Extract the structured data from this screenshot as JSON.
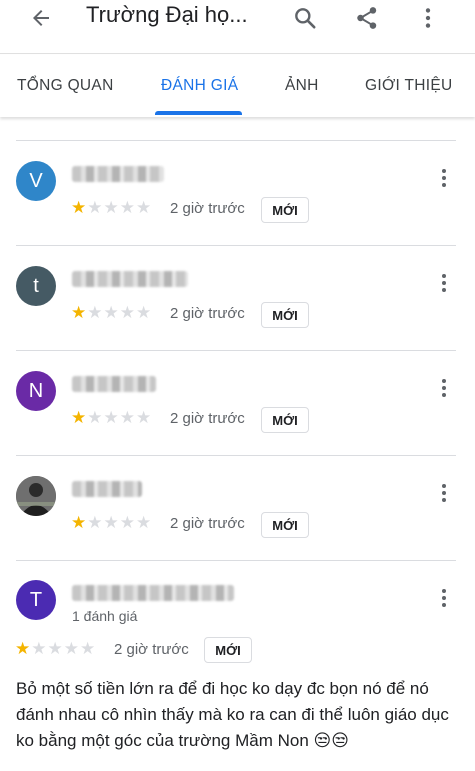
{
  "header": {
    "title": "Trường Đại họ..."
  },
  "tabs": [
    {
      "label": "TỔNG QUAN"
    },
    {
      "label": "ĐÁNH GIÁ"
    },
    {
      "label": "ẢNH"
    },
    {
      "label": "GIỚI THIỆU"
    }
  ],
  "active_tab": "ĐÁNH GIÁ",
  "colors": {
    "accent": "#1a73e8",
    "star_filled": "#f4b400",
    "star_empty": "#dadce0"
  },
  "reviews": [
    {
      "avatar_letter": "V",
      "avatar_color": "#2f86c9",
      "rating": 1,
      "time": "2 giờ trước",
      "badge": "MỚI"
    },
    {
      "avatar_letter": "t",
      "avatar_color": "#455a64",
      "rating": 1,
      "time": "2 giờ trước",
      "badge": "MỚI"
    },
    {
      "avatar_letter": "N",
      "avatar_color": "#6a2aa6",
      "rating": 1,
      "time": "2 giờ trước",
      "badge": "MỚI"
    },
    {
      "avatar_letter": "",
      "avatar_color": "#3a3a3a",
      "rating": 1,
      "time": "2 giờ trước",
      "badge": "MỚI"
    },
    {
      "avatar_letter": "T",
      "avatar_color": "#4b2bb2",
      "subtitle": "1 đánh giá",
      "rating": 1,
      "time": "2 giờ trước",
      "badge": "MỚI",
      "text": "Bỏ một số tiền lớn ra để đi học ko dạy đc bọn  nó để nó đánh nhau cô nhìn thấy mà ko ra can đi thể luôn giáo dục ko bằng một góc của trường Mầm Non 😒😒"
    }
  ]
}
